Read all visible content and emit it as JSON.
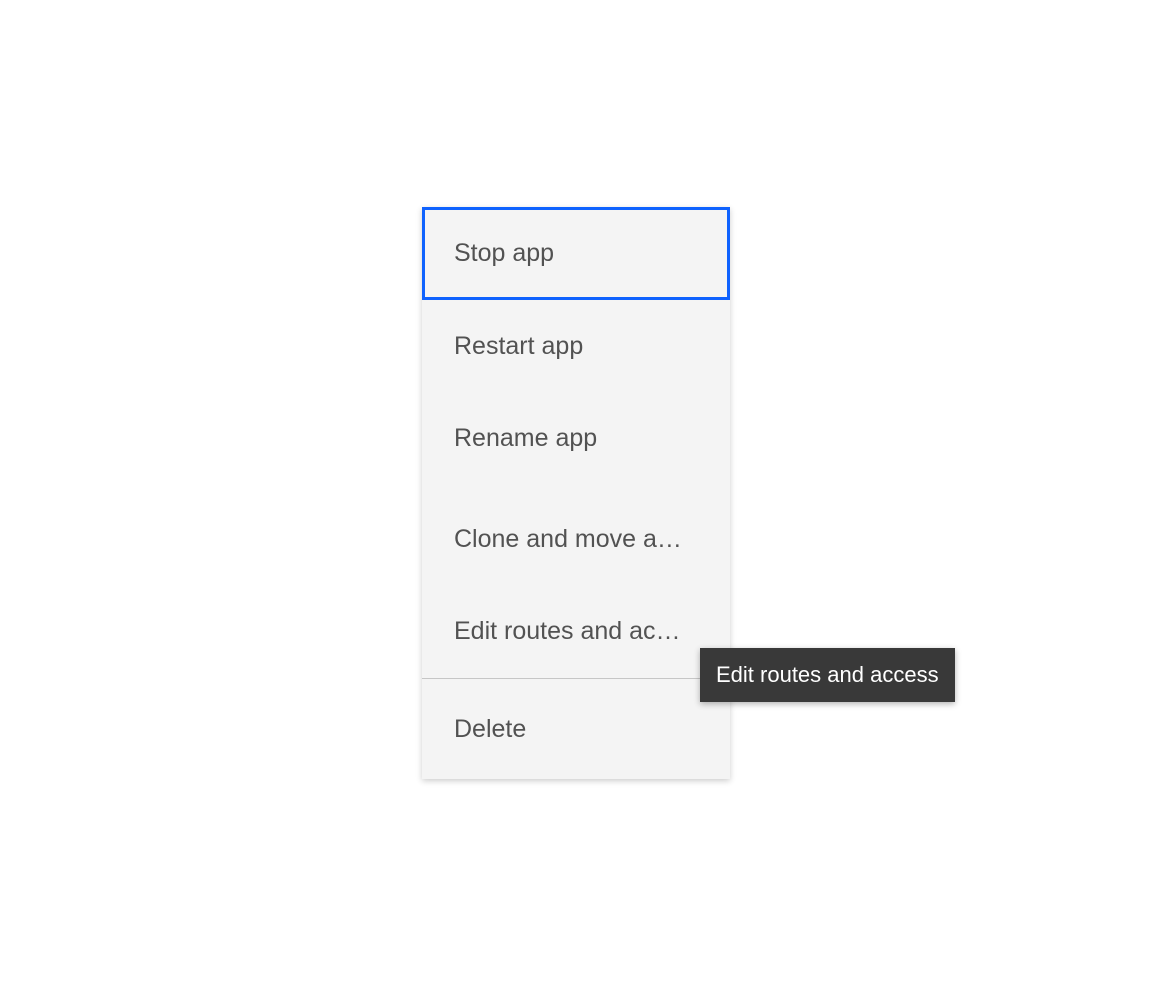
{
  "menu": {
    "items": [
      {
        "label": "Stop app"
      },
      {
        "label": "Restart app"
      },
      {
        "label": "Rename app"
      },
      {
        "label": "Clone and move a…"
      },
      {
        "label": "Edit routes and ac…"
      },
      {
        "label": "Delete"
      }
    ]
  },
  "tooltip": {
    "text": "Edit routes and access"
  }
}
